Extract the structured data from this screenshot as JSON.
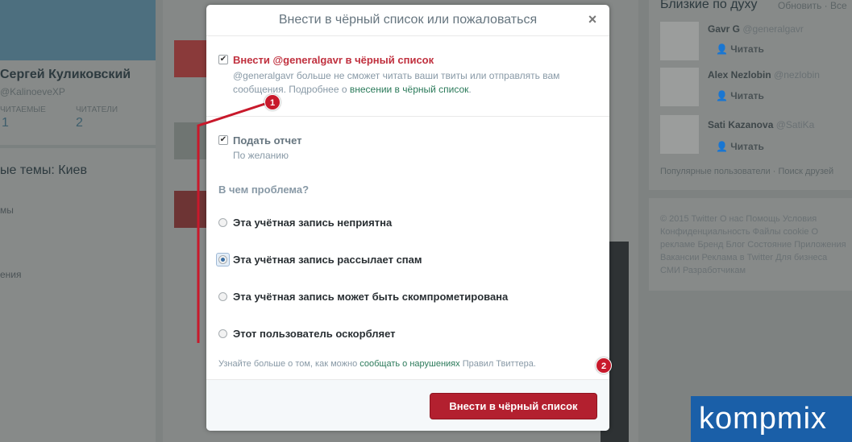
{
  "background": {
    "profile_name": "Сергей Куликовский",
    "profile_handle": "@KalinoeveXP",
    "stats": [
      {
        "label": "ЧИТАЕМЫЕ",
        "value": "1"
      },
      {
        "label": "ЧИТАТЕЛИ",
        "value": "2"
      }
    ],
    "trends_title": "ые темы: Киев",
    "left_items": [
      "мы",
      "ения"
    ],
    "right_title": "Близкие по духу",
    "right_links": "Обновить · Все",
    "suggestions": [
      {
        "name": "Gavr G",
        "handle": "@generalgavr",
        "follow": "Читать"
      },
      {
        "name": "Alex Nezlobin",
        "handle": "@nezlobin",
        "follow": "Читать"
      },
      {
        "name": "Sati Kazanova",
        "handle": "@SatiKa",
        "follow": "Читать"
      }
    ],
    "right_footer": "Популярные пользователи · Поиск друзей",
    "copyright": "© 2015 Twitter  О нас  Помощь  Условия  Конфиденциальность  Файлы cookie  О рекламе  Бренд  Блог  Состояние  Приложения  Вакансии  Реклама в Twitter  Для бизнеса  СМИ  Разработчикам"
  },
  "modal": {
    "title": "Внести в чёрный список или пожаловаться",
    "close_symbol": "×",
    "block": {
      "checked": true,
      "label": "Внести @generalgavr в чёрный список",
      "desc_prefix": "@generalgavr больше не сможет читать ваши твиты или отправлять вам сообщения. Подробнее о ",
      "desc_link": "внесении в чёрный список",
      "desc_suffix": "."
    },
    "report": {
      "checked": true,
      "label": "Подать отчет",
      "sublabel": "По желанию"
    },
    "question": "В чем проблема?",
    "options": [
      {
        "label": "Эта учётная запись неприятна",
        "selected": false
      },
      {
        "label": "Эта учётная запись рассылает спам",
        "selected": true
      },
      {
        "label": "Эта учётная запись может быть скомпрометирована",
        "selected": false
      },
      {
        "label": "Этот пользователь оскорбляет",
        "selected": false
      }
    ],
    "learn_prefix": "Узнайте больше о том, как можно ",
    "learn_link": "сообщать о нарушениях",
    "learn_suffix": " Правил Твиттера.",
    "submit_label": "Внести в чёрный список"
  },
  "annotations": {
    "callout_1": "1",
    "callout_2": "2",
    "accent_color": "#c8192b"
  },
  "watermark": "kompmix"
}
